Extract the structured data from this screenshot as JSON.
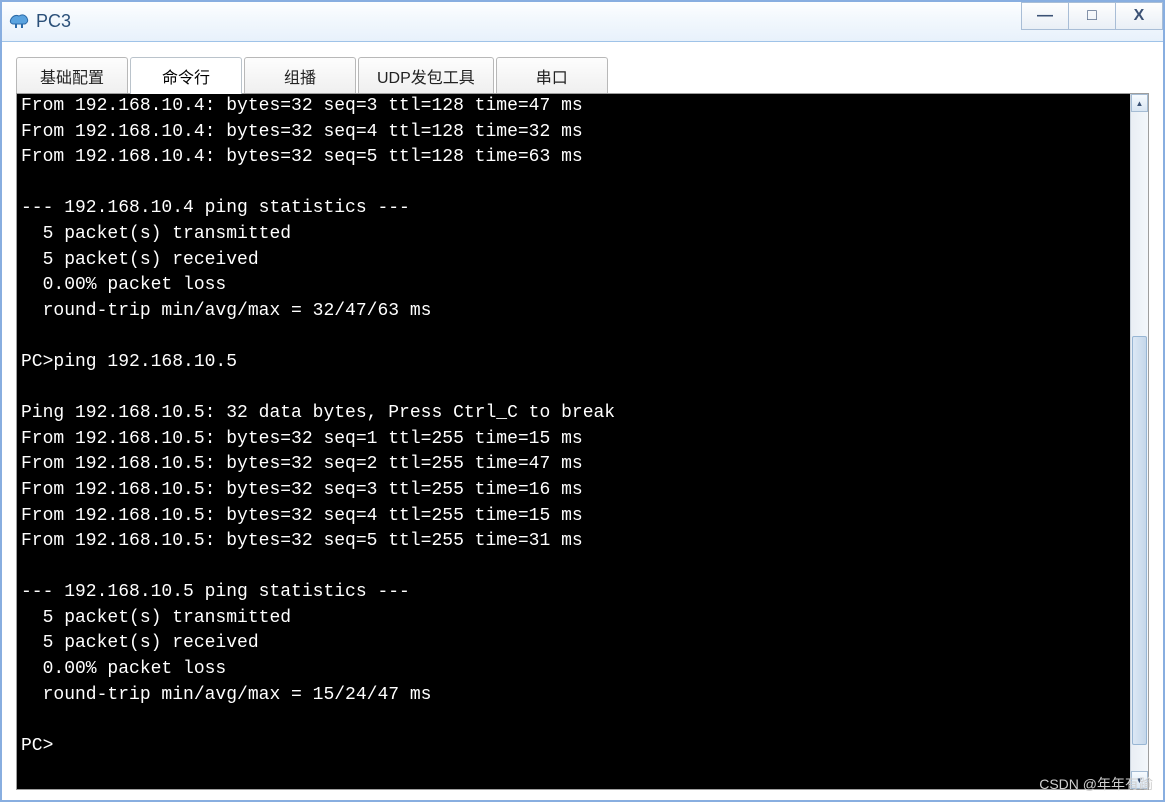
{
  "window": {
    "title": "PC3",
    "controls": {
      "minimize": "—",
      "maximize": "□",
      "close": "X"
    }
  },
  "tabs": [
    {
      "label": "基础配置",
      "active": false
    },
    {
      "label": "命令行",
      "active": true
    },
    {
      "label": "组播",
      "active": false
    },
    {
      "label": "UDP发包工具",
      "active": false
    },
    {
      "label": "串口",
      "active": false
    }
  ],
  "terminal": {
    "prompt": "PC>",
    "sessions": [
      {
        "target": "192.168.10.4",
        "replies": [
          {
            "host": "192.168.10.4",
            "bytes": 32,
            "seq": 3,
            "ttl": 128,
            "time_ms": 47
          },
          {
            "host": "192.168.10.4",
            "bytes": 32,
            "seq": 4,
            "ttl": 128,
            "time_ms": 32
          },
          {
            "host": "192.168.10.4",
            "bytes": 32,
            "seq": 5,
            "ttl": 128,
            "time_ms": 63
          }
        ],
        "stats": {
          "header": "--- 192.168.10.4 ping statistics ---",
          "transmitted": 5,
          "received": 5,
          "loss_pct": "0.00%",
          "rtt": {
            "min": 32,
            "avg": 47,
            "max": 63
          }
        }
      },
      {
        "target": "192.168.10.5",
        "command": "ping 192.168.10.5",
        "banner": "Ping 192.168.10.5: 32 data bytes, Press Ctrl_C to break",
        "replies": [
          {
            "host": "192.168.10.5",
            "bytes": 32,
            "seq": 1,
            "ttl": 255,
            "time_ms": 15
          },
          {
            "host": "192.168.10.5",
            "bytes": 32,
            "seq": 2,
            "ttl": 255,
            "time_ms": 47
          },
          {
            "host": "192.168.10.5",
            "bytes": 32,
            "seq": 3,
            "ttl": 255,
            "time_ms": 16
          },
          {
            "host": "192.168.10.5",
            "bytes": 32,
            "seq": 4,
            "ttl": 255,
            "time_ms": 15
          },
          {
            "host": "192.168.10.5",
            "bytes": 32,
            "seq": 5,
            "ttl": 255,
            "time_ms": 31
          }
        ],
        "stats": {
          "header": "--- 192.168.10.5 ping statistics ---",
          "transmitted": 5,
          "received": 5,
          "loss_pct": "0.00%",
          "rtt": {
            "min": 15,
            "avg": 24,
            "max": 47
          }
        }
      }
    ]
  },
  "watermark": "CSDN @年年有踰"
}
